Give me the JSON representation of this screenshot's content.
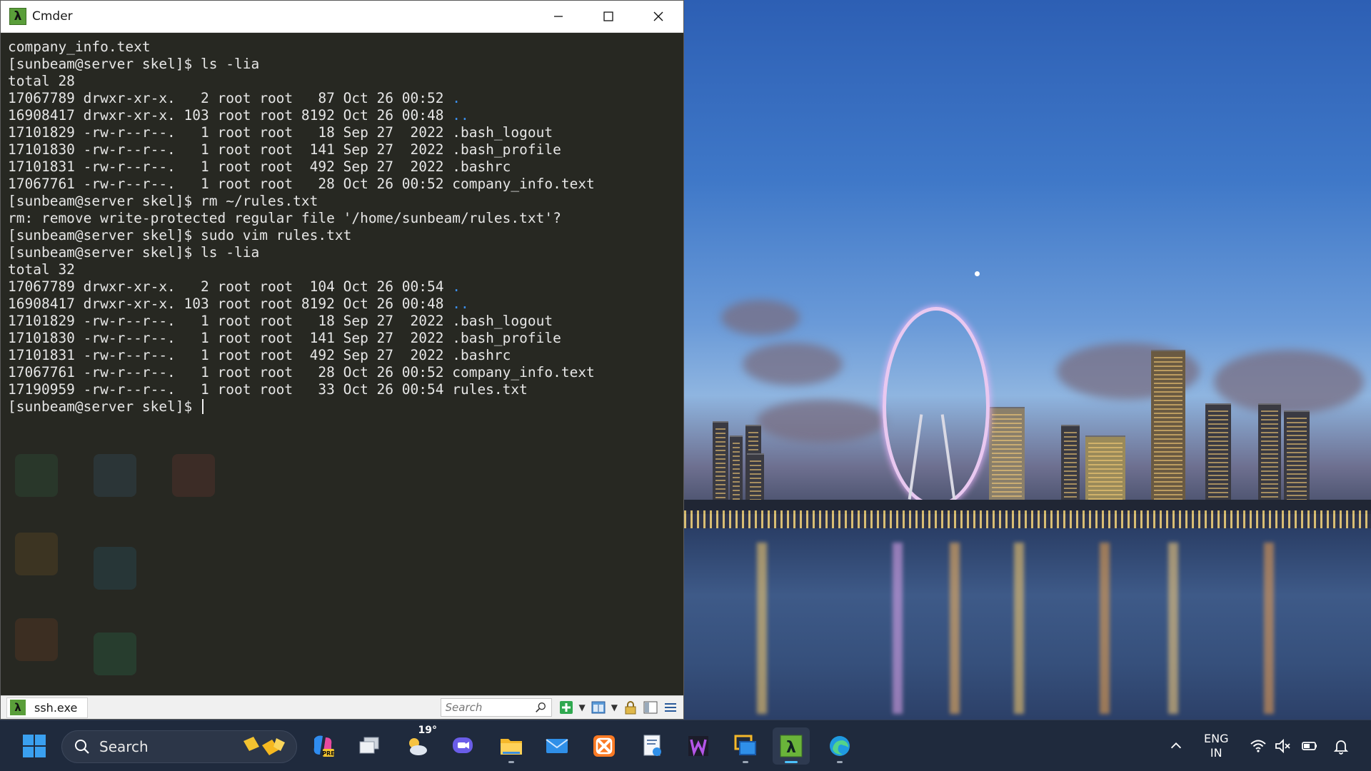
{
  "window": {
    "title": "Cmder",
    "app_icon_glyph": "λ"
  },
  "terminal": {
    "lines": [
      {
        "text": "company_info.text"
      },
      {
        "text": "[sunbeam@server skel]$ ls -lia"
      },
      {
        "text": "total 28"
      },
      {
        "text": "17067789 drwxr-xr-x.   2 root root   87 Oct 26 00:52 ",
        "dir": "."
      },
      {
        "text": "16908417 drwxr-xr-x. 103 root root 8192 Oct 26 00:48 ",
        "dir": ".."
      },
      {
        "text": "17101829 -rw-r--r--.   1 root root   18 Sep 27  2022 .bash_logout"
      },
      {
        "text": "17101830 -rw-r--r--.   1 root root  141 Sep 27  2022 .bash_profile"
      },
      {
        "text": "17101831 -rw-r--r--.   1 root root  492 Sep 27  2022 .bashrc"
      },
      {
        "text": "17067761 -rw-r--r--.   1 root root   28 Oct 26 00:52 company_info.text"
      },
      {
        "text": "[sunbeam@server skel]$ rm ~/rules.txt"
      },
      {
        "text": "rm: remove write-protected regular file '/home/sunbeam/rules.txt'?"
      },
      {
        "text": "[sunbeam@server skel]$ sudo vim rules.txt"
      },
      {
        "text": "[sunbeam@server skel]$ ls -lia"
      },
      {
        "text": "total 32"
      },
      {
        "text": "17067789 drwxr-xr-x.   2 root root  104 Oct 26 00:54 ",
        "dir": "."
      },
      {
        "text": "16908417 drwxr-xr-x. 103 root root 8192 Oct 26 00:48 ",
        "dir": ".."
      },
      {
        "text": "17101829 -rw-r--r--.   1 root root   18 Sep 27  2022 .bash_logout"
      },
      {
        "text": "17101830 -rw-r--r--.   1 root root  141 Sep 27  2022 .bash_profile"
      },
      {
        "text": "17101831 -rw-r--r--.   1 root root  492 Sep 27  2022 .bashrc"
      },
      {
        "text": "17067761 -rw-r--r--.   1 root root   28 Oct 26 00:52 company_info.text"
      },
      {
        "text": "17190959 -rw-r--r--.   1 root root   33 Oct 26 00:54 rules.txt"
      }
    ],
    "prompt": "[sunbeam@server skel]$ ",
    "colors": {
      "background": "#272822",
      "text": "#e6e6e6",
      "directory": "#3b8eea"
    }
  },
  "statusbar": {
    "console_tab_label": "ssh.exe",
    "search_placeholder": "Search",
    "icons": [
      "search-icon",
      "new-console-icon",
      "split-view-icon",
      "lock-icon",
      "tab-list-icon",
      "menu-icon"
    ]
  },
  "taskbar": {
    "search_label": "Search",
    "weather_temp": "19°",
    "language_line1": "ENG",
    "language_line2": "IN",
    "apps": [
      "windows-start-icon",
      "copilot-icon",
      "task-view-icon",
      "weather-icon",
      "chat-icon",
      "file-explorer-icon",
      "mail-icon",
      "xampp-icon",
      "script-editor-icon",
      "wamp-icon",
      "remote-desktop-icon",
      "cmder-icon",
      "edge-icon"
    ],
    "accent": "#4cc2ff"
  }
}
